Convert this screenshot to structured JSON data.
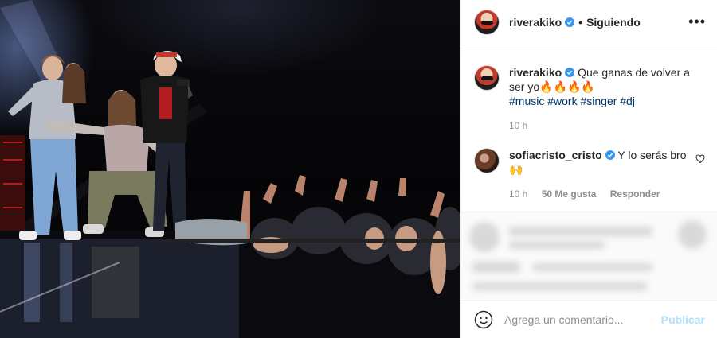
{
  "post": {
    "username": "riverakiko",
    "separator": "•",
    "follow_status": "Siguiendo",
    "more_icon": "more-options-icon"
  },
  "caption": {
    "username": "riverakiko",
    "text": "Que ganas de volver a ser yo🔥🔥🔥🔥",
    "hashtags": "#music #work #singer #dj",
    "time": "10 h"
  },
  "comment": {
    "username": "sofiacristo_cristo",
    "text": "Y lo serás bro",
    "emoji": "🙌",
    "time": "10 h",
    "likes": "50 Me gusta",
    "reply": "Responder"
  },
  "composer": {
    "placeholder": "Agrega un comentario...",
    "publish_label": "Publicar"
  },
  "colors": {
    "link": "#00376b",
    "verified": "#3897f0",
    "publish_disabled": "#b2dffc"
  }
}
